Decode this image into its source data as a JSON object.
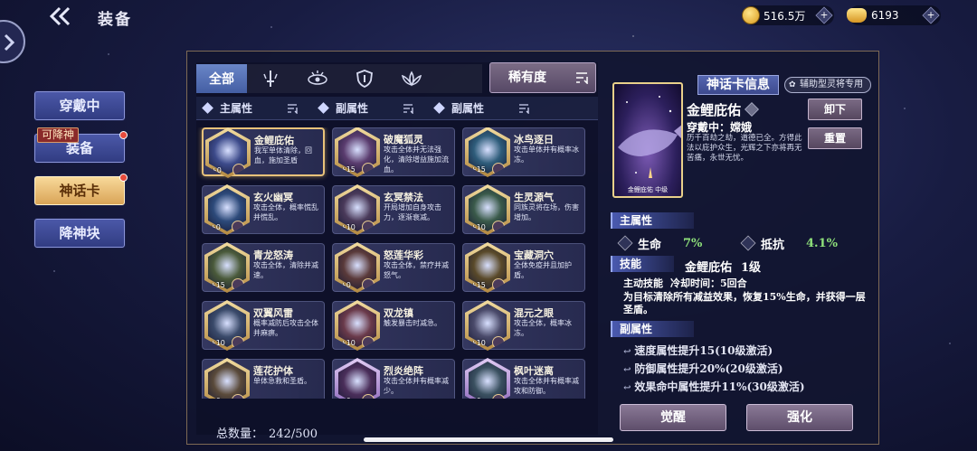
{
  "header": {
    "title": "装备",
    "gold": "516.5万",
    "ingot": "6193"
  },
  "nav": {
    "items": [
      {
        "label": "穿戴中"
      },
      {
        "label": "装备",
        "tag": "可降神"
      },
      {
        "label": "神话卡"
      },
      {
        "label": "降神块"
      }
    ]
  },
  "tabs": {
    "all": "全部",
    "rarity": "稀有度"
  },
  "filters": [
    "主属性",
    "副属性",
    "副属性"
  ],
  "cards": [
    {
      "name": "金鲤庇佑",
      "desc": "我军单体清除，回血，施加圣盾",
      "lvl": "+0"
    },
    {
      "name": "破魔狐灵",
      "desc": "攻击全体并无法强化，清除增益施加流血。",
      "lvl": "+15"
    },
    {
      "name": "冰鸟逐日",
      "desc": "攻击单体并有概率冰冻。",
      "lvl": "+15"
    },
    {
      "name": "玄火幽冥",
      "desc": "攻击全体，概率慌乱并慌乱。",
      "lvl": "+0"
    },
    {
      "name": "玄冥禁法",
      "desc": "开局增加自身攻击力，逐渐衰减。",
      "lvl": "+10"
    },
    {
      "name": "生灵源气",
      "desc": "同族灵将在场，伤害增加。",
      "lvl": "+10"
    },
    {
      "name": "青龙怒涛",
      "desc": "攻击全体，清除并减速。",
      "lvl": "+15"
    },
    {
      "name": "怒莲华彩",
      "desc": "攻击全体，禁疗并减怒气。",
      "lvl": "+0"
    },
    {
      "name": "宝藏洞穴",
      "desc": "全体免疫并且加护盾。",
      "lvl": "+15"
    },
    {
      "name": "双翼风雷",
      "desc": "概率减防后攻击全体并麻痹。",
      "lvl": "+10"
    },
    {
      "name": "双龙镇",
      "desc": "触发暴击时减急。",
      "lvl": "+10"
    },
    {
      "name": "混元之眼",
      "desc": "攻击全体，概率冰冻。",
      "lvl": "+10"
    },
    {
      "name": "莲花护体",
      "desc": "单体急救和圣盾。",
      "lvl": "+0"
    },
    {
      "name": "烈炎绝阵",
      "desc": "攻击全体并有概率减少。",
      "lvl": "+0"
    },
    {
      "name": "枫叶迷离",
      "desc": "攻击全体并有概率减攻和防御。",
      "lvl": "+0"
    }
  ],
  "total": {
    "label": "总数量：",
    "value": "242/500"
  },
  "info": {
    "title": "神话卡信息",
    "support_tag": "辅助型灵将专用",
    "card_name": "金鲤庇佑",
    "art_label": "金鲤庇佑  中级",
    "equipped": "穿戴中：嫦娥",
    "flavor": "历千百劫之劫，道德已全。方得此法以庇护众生，光辉之下亦将再无苦痛，永世无忧。",
    "unequip": "卸下",
    "reset": "重置",
    "main_attr_header": "主属性",
    "stat1_name": "生命",
    "stat1_val": "7%",
    "stat2_name": "抵抗",
    "stat2_val": "4.1%",
    "skill_header": "技能",
    "skill_name": "金鲤庇佑",
    "skill_level": "1级",
    "skill_type": "主动技能",
    "cooldown": "冷却时间：5回合",
    "skill_desc": "为目标清除所有减益效果，恢复15%生命，并获得一层圣盾。",
    "sub_attr_header": "副属性",
    "sub_attrs": [
      "速度属性提升15(10级激活)",
      "防御属性提升20%(20级激活)",
      "效果命中属性提升11%(30级激活)"
    ],
    "awaken": "觉醒",
    "enhance": "强化"
  }
}
